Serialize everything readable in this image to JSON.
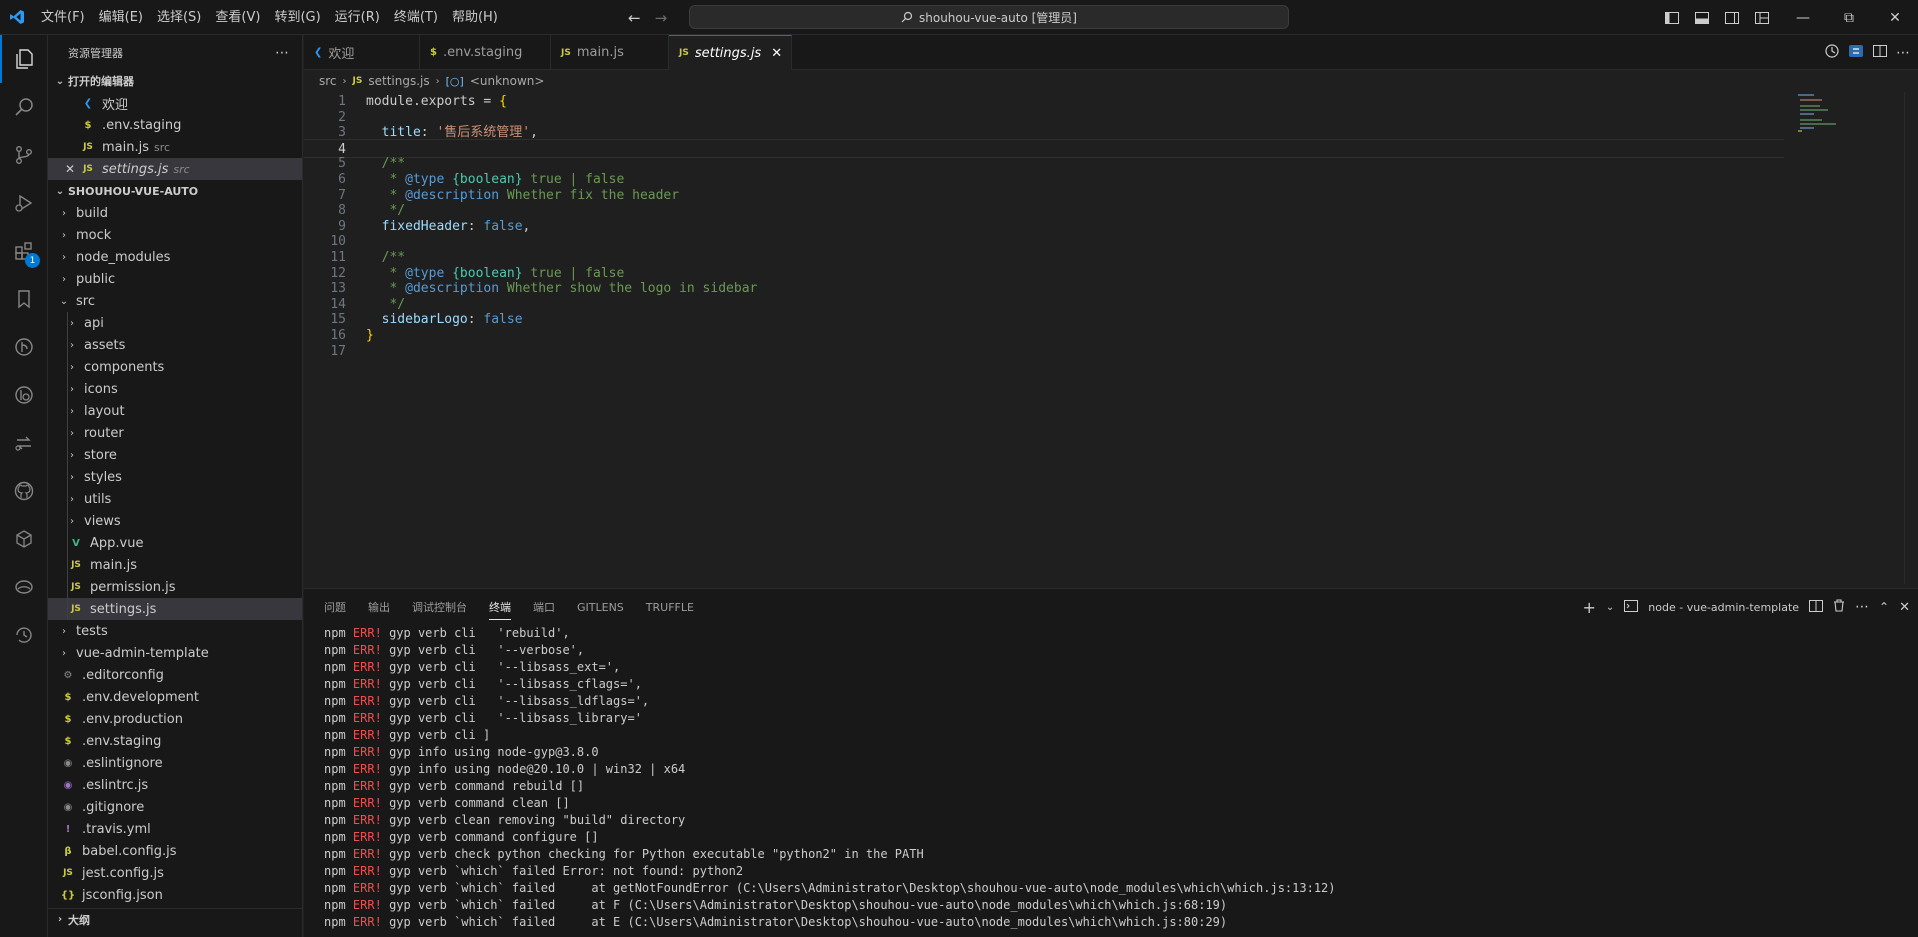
{
  "menu": [
    "文件(F)",
    "编辑(E)",
    "选择(S)",
    "查看(V)",
    "转到(G)",
    "运行(R)",
    "终端(T)",
    "帮助(H)"
  ],
  "command_center": "shouhou-vue-auto [管理员]",
  "sidebar": {
    "title": "资源管理器",
    "open_editors_label": "打开的编辑器",
    "open_editors": [
      {
        "icon": "vscode",
        "name": "欢迎",
        "desc": ""
      },
      {
        "icon": "env",
        "name": ".env.staging",
        "desc": ""
      },
      {
        "icon": "js",
        "name": "main.js",
        "desc": "src"
      },
      {
        "icon": "js",
        "name": "settings.js",
        "desc": "src"
      }
    ],
    "project_label": "SHOUHOU-VUE-AUTO",
    "tree": [
      {
        "depth": 0,
        "type": "folder",
        "name": "build"
      },
      {
        "depth": 0,
        "type": "folder",
        "name": "mock"
      },
      {
        "depth": 0,
        "type": "folder",
        "name": "node_modules"
      },
      {
        "depth": 0,
        "type": "folder",
        "name": "public"
      },
      {
        "depth": 0,
        "type": "folder-open",
        "name": "src"
      },
      {
        "depth": 1,
        "type": "folder",
        "name": "api"
      },
      {
        "depth": 1,
        "type": "folder",
        "name": "assets"
      },
      {
        "depth": 1,
        "type": "folder",
        "name": "components"
      },
      {
        "depth": 1,
        "type": "folder",
        "name": "icons"
      },
      {
        "depth": 1,
        "type": "folder",
        "name": "layout"
      },
      {
        "depth": 1,
        "type": "folder",
        "name": "router"
      },
      {
        "depth": 1,
        "type": "folder",
        "name": "store"
      },
      {
        "depth": 1,
        "type": "folder",
        "name": "styles"
      },
      {
        "depth": 1,
        "type": "folder",
        "name": "utils"
      },
      {
        "depth": 1,
        "type": "folder",
        "name": "views"
      },
      {
        "depth": 1,
        "type": "vue",
        "name": "App.vue"
      },
      {
        "depth": 1,
        "type": "js",
        "name": "main.js"
      },
      {
        "depth": 1,
        "type": "js",
        "name": "permission.js"
      },
      {
        "depth": 1,
        "type": "js",
        "name": "settings.js"
      },
      {
        "depth": 0,
        "type": "folder",
        "name": "tests"
      },
      {
        "depth": 0,
        "type": "folder",
        "name": "vue-admin-template"
      },
      {
        "depth": 0,
        "type": "config",
        "name": ".editorconfig"
      },
      {
        "depth": 0,
        "type": "env",
        "name": ".env.development"
      },
      {
        "depth": 0,
        "type": "env",
        "name": ".env.production"
      },
      {
        "depth": 0,
        "type": "env",
        "name": ".env.staging"
      },
      {
        "depth": 0,
        "type": "git",
        "name": ".eslintignore"
      },
      {
        "depth": 0,
        "type": "eslint",
        "name": ".eslintrc.js"
      },
      {
        "depth": 0,
        "type": "git",
        "name": ".gitignore"
      },
      {
        "depth": 0,
        "type": "yml",
        "name": ".travis.yml"
      },
      {
        "depth": 0,
        "type": "babel",
        "name": "babel.config.js"
      },
      {
        "depth": 0,
        "type": "js",
        "name": "jest.config.js"
      },
      {
        "depth": 0,
        "type": "json",
        "name": "jsconfig.json"
      }
    ],
    "outline_label": "大纲"
  },
  "tabs": [
    {
      "icon": "vscode",
      "label": "欢迎"
    },
    {
      "icon": "env",
      "label": ".env.staging"
    },
    {
      "icon": "js",
      "label": "main.js"
    },
    {
      "icon": "js",
      "label": "settings.js"
    }
  ],
  "breadcrumb": [
    "src",
    "settings.js",
    "<unknown>"
  ],
  "code": [
    [
      [
        "t-plain",
        "module"
      ],
      [
        "t-plain",
        "."
      ],
      [
        "t-plain",
        "exports"
      ],
      [
        "t-plain",
        " = "
      ],
      [
        "t-brace",
        "{"
      ]
    ],
    [],
    [
      [
        "t-plain",
        "  "
      ],
      [
        "t-key",
        "title"
      ],
      [
        "t-plain",
        ": "
      ],
      [
        "t-str",
        "'售后系统管理'"
      ],
      [
        "t-plain",
        ","
      ]
    ],
    [],
    [
      [
        "t-com",
        "  /**"
      ]
    ],
    [
      [
        "t-com",
        "   * "
      ],
      [
        "t-tag",
        "@type"
      ],
      [
        "t-com",
        " "
      ],
      [
        "t-type",
        "{boolean}"
      ],
      [
        "t-com",
        " true | false"
      ]
    ],
    [
      [
        "t-com",
        "   * "
      ],
      [
        "t-tag",
        "@description"
      ],
      [
        "t-com",
        " Whether fix the header"
      ]
    ],
    [
      [
        "t-com",
        "   */"
      ]
    ],
    [
      [
        "t-plain",
        "  "
      ],
      [
        "t-key",
        "fixedHeader"
      ],
      [
        "t-plain",
        ": "
      ],
      [
        "t-kw",
        "false"
      ],
      [
        "t-plain",
        ","
      ]
    ],
    [],
    [
      [
        "t-com",
        "  /**"
      ]
    ],
    [
      [
        "t-com",
        "   * "
      ],
      [
        "t-tag",
        "@type"
      ],
      [
        "t-com",
        " "
      ],
      [
        "t-type",
        "{boolean}"
      ],
      [
        "t-com",
        " true | false"
      ]
    ],
    [
      [
        "t-com",
        "   * "
      ],
      [
        "t-tag",
        "@description"
      ],
      [
        "t-com",
        " Whether show the logo in sidebar"
      ]
    ],
    [
      [
        "t-com",
        "   */"
      ]
    ],
    [
      [
        "t-plain",
        "  "
      ],
      [
        "t-key",
        "sidebarLogo"
      ],
      [
        "t-plain",
        ": "
      ],
      [
        "t-kw",
        "false"
      ]
    ],
    [
      [
        "t-brace",
        "}"
      ]
    ],
    []
  ],
  "current_line": 4,
  "panel": {
    "tabs": [
      "问题",
      "输出",
      "调试控制台",
      "终端",
      "端口",
      "GITLENS",
      "TRUFFLE"
    ],
    "active_tab": "终端",
    "terminal_name": "node - vue-admin-template",
    "lines": [
      "gyp verb cli   'rebuild',",
      "gyp verb cli   '--verbose',",
      "gyp verb cli   '--libsass_ext=',",
      "gyp verb cli   '--libsass_cflags=',",
      "gyp verb cli   '--libsass_ldflags=',",
      "gyp verb cli   '--libsass_library='",
      "gyp verb cli ]",
      "gyp info using node-gyp@3.8.0",
      "gyp info using node@20.10.0 | win32 | x64",
      "gyp verb command rebuild []",
      "gyp verb command clean []",
      "gyp verb clean removing \"build\" directory",
      "gyp verb command configure []",
      "gyp verb check python checking for Python executable \"python2\" in the PATH",
      "gyp verb `which` failed Error: not found: python2",
      "gyp verb `which` failed     at getNotFoundError (C:\\Users\\Administrator\\Desktop\\shouhou-vue-auto\\node_modules\\which\\which.js:13:12)",
      "gyp verb `which` failed     at F (C:\\Users\\Administrator\\Desktop\\shouhou-vue-auto\\node_modules\\which\\which.js:68:19)",
      "gyp verb `which` failed     at E (C:\\Users\\Administrator\\Desktop\\shouhou-vue-auto\\node_modules\\which\\which.js:80:29)"
    ],
    "line_prefix": "npm",
    "line_err": "ERR!"
  }
}
